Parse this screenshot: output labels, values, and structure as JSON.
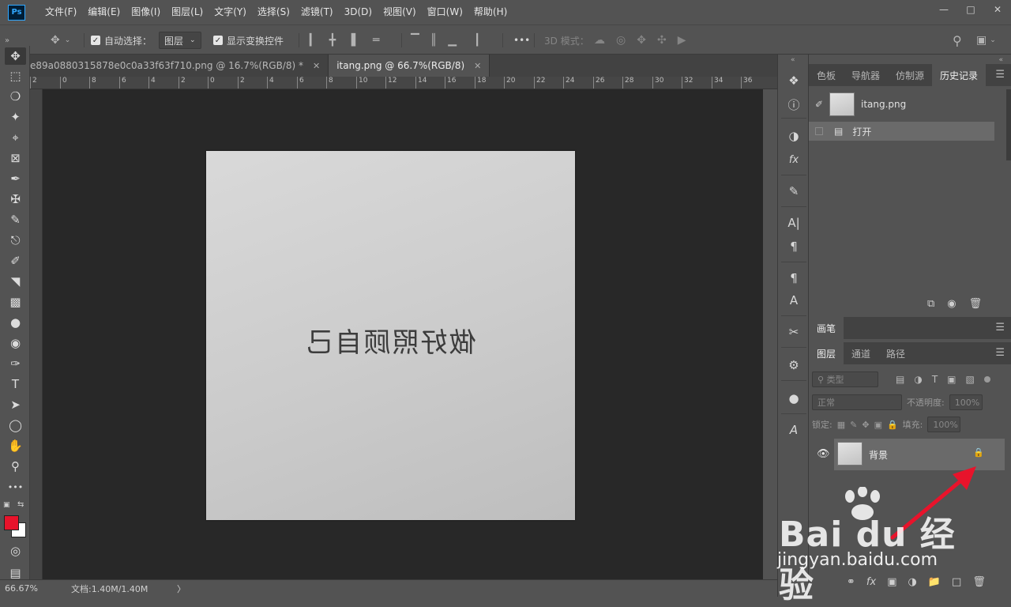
{
  "app": {
    "logo": "Ps"
  },
  "menu": [
    "文件(F)",
    "编辑(E)",
    "图像(I)",
    "图层(L)",
    "文字(Y)",
    "选择(S)",
    "滤镜(T)",
    "3D(D)",
    "视图(V)",
    "窗口(W)",
    "帮助(H)"
  ],
  "options": {
    "auto_select_label": "自动选择：",
    "auto_select_value": "图层",
    "show_transform_label": "显示变换控件",
    "more": "•••",
    "mode_3d_label": "3D 模式："
  },
  "tabs": [
    {
      "label": "e89a0880315878e0c0a33f63f710.png @ 16.7%(RGB/8) *",
      "active": false
    },
    {
      "label": "itang.png @ 66.7%(RGB/8)",
      "active": true
    }
  ],
  "ruler": [
    "2",
    "0",
    "8",
    "6",
    "4",
    "2",
    "0",
    "2",
    "4",
    "6",
    "8",
    "10",
    "12",
    "14",
    "16",
    "18",
    "20",
    "22",
    "24",
    "26",
    "28",
    "30",
    "32",
    "34",
    "36"
  ],
  "document": {
    "handwriting": "做好照顾自己"
  },
  "status": {
    "zoom": "66.67%",
    "doc_size": "文档:1.40M/1.40M",
    "arrow": "〉"
  },
  "history_panel": {
    "tabs": [
      "色板",
      "导航器",
      "仿制源",
      "历史记录"
    ],
    "snapshot_name": "itang.png",
    "items": [
      "打开"
    ]
  },
  "brush_panel": {
    "title": "画笔"
  },
  "layers_panel": {
    "tabs": [
      "图层",
      "通道",
      "路径"
    ],
    "filter_placeholder": "类型",
    "blend_mode": "正常",
    "opacity_label": "不透明度:",
    "opacity_value": "100%",
    "lock_label": "锁定:",
    "fill_label": "填充:",
    "fill_value": "100%",
    "layers": [
      {
        "name": "背景",
        "locked": true,
        "visible": true
      }
    ]
  },
  "watermark": {
    "brand": "Bai du 经验",
    "url": "jingyan.baidu.com"
  },
  "colors": {
    "foreground": "#e8132b",
    "background": "#ffffff",
    "annotation_arrow": "#e8132b"
  }
}
